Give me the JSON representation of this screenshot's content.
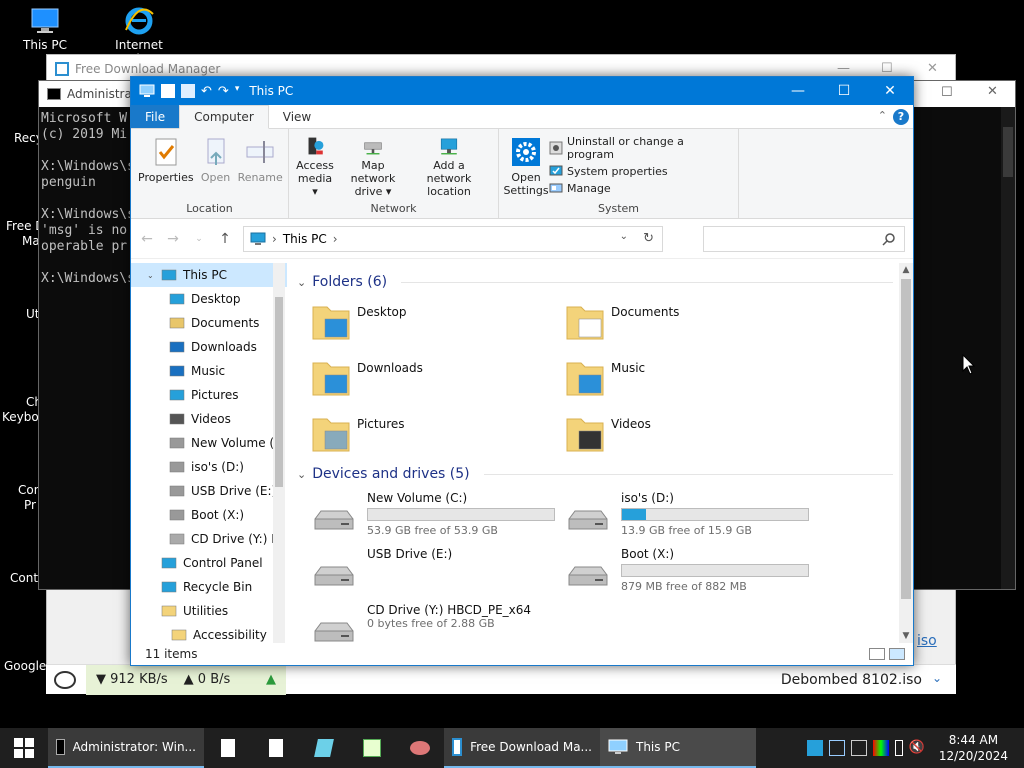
{
  "desktop": {
    "icons": [
      {
        "label": "This PC"
      },
      {
        "label": "Internet Explorer"
      }
    ],
    "partial_labels": [
      "Recy",
      "Free D",
      "Ma",
      "Ut",
      "Ch",
      "Keyboa",
      "Con",
      "Pr",
      "Contr",
      "Google"
    ]
  },
  "fdm_window": {
    "title": "Free Download Manager",
    "download_speed": "▼ 912 KB/s",
    "upload_speed": "▲ 0 B/s",
    "file_name": "Debombed 8102.iso",
    "link_fragment": "iso"
  },
  "cmd_window": {
    "title": "Administrat",
    "lines": [
      "Microsoft W",
      "(c) 2019 Mi",
      "",
      "X:\\Windows\\s",
      "penguin",
      "",
      "X:\\Windows\\s",
      "'msg' is no",
      "operable pr",
      "",
      "X:\\Windows\\s"
    ]
  },
  "explorer": {
    "title": "This PC",
    "tabs": [
      {
        "label": "File"
      },
      {
        "label": "Computer"
      },
      {
        "label": "View"
      }
    ],
    "help_label": "?",
    "ribbon": {
      "location": {
        "label": "Location",
        "buttons": [
          {
            "label": "Properties"
          },
          {
            "label": "Open"
          },
          {
            "label": "Rename"
          }
        ]
      },
      "network": {
        "label": "Network",
        "buttons": [
          {
            "label": "Access media ▾"
          },
          {
            "label": "Map network drive ▾"
          },
          {
            "label": "Add a network location"
          }
        ]
      },
      "system": {
        "label": "System",
        "open_settings": "Open Settings",
        "items": [
          {
            "label": "Uninstall or change a program"
          },
          {
            "label": "System properties"
          },
          {
            "label": "Manage"
          }
        ]
      }
    },
    "address": {
      "path": "This PC",
      "search_placeholder": ""
    },
    "nav": [
      {
        "label": "This PC",
        "selected": true
      },
      {
        "label": "Desktop"
      },
      {
        "label": "Documents"
      },
      {
        "label": "Downloads"
      },
      {
        "label": "Music"
      },
      {
        "label": "Pictures"
      },
      {
        "label": "Videos"
      },
      {
        "label": "New Volume (C"
      },
      {
        "label": "iso's (D:)"
      },
      {
        "label": "USB Drive (E:)"
      },
      {
        "label": "Boot (X:)"
      },
      {
        "label": "CD Drive (Y:) H"
      },
      {
        "label": "Control Panel"
      },
      {
        "label": "Recycle Bin"
      },
      {
        "label": "Utilities"
      },
      {
        "label": "Accessibility"
      }
    ],
    "folders_header": "Folders (6)",
    "folders": [
      {
        "label": "Desktop"
      },
      {
        "label": "Documents"
      },
      {
        "label": "Downloads"
      },
      {
        "label": "Music"
      },
      {
        "label": "Pictures"
      },
      {
        "label": "Videos"
      }
    ],
    "drives_header": "Devices and drives (5)",
    "drives": [
      {
        "label": "New Volume (C:)",
        "free": "53.9 GB free of 53.9 GB",
        "used_fraction": 0.0
      },
      {
        "label": "iso's (D:)",
        "free": "13.9 GB free of 15.9 GB",
        "used_fraction": 0.13
      },
      {
        "label": "USB Drive (E:)",
        "free": "",
        "used_fraction": null
      },
      {
        "label": "Boot (X:)",
        "free": "879 MB free of 882 MB",
        "used_fraction": 0.0
      },
      {
        "label": "CD Drive (Y:) HBCD_PE_x64",
        "free": "0 bytes free of 2.88 GB",
        "used_fraction": null
      }
    ],
    "status": "11 items"
  },
  "taskbar": {
    "items": [
      {
        "label": "Administrator: Win..."
      },
      {
        "label": "Free Download Ma..."
      },
      {
        "label": "This PC"
      }
    ],
    "clock_time": "8:44 AM",
    "clock_date": "12/20/2024"
  },
  "colors": {
    "accent": "#0078d7",
    "drive_bar": "#26a0da",
    "section_header": "#1e3287"
  }
}
